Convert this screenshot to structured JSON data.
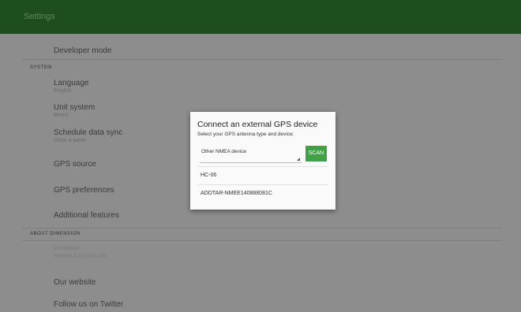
{
  "appbar": {
    "title": "Settings"
  },
  "settings": {
    "developer_mode": "Developer mode",
    "section_system": "SYSTEM",
    "language": {
      "title": "Language",
      "summary": "English"
    },
    "unit_system": {
      "title": "Unit system",
      "summary": "Metric"
    },
    "schedule_sync": {
      "title": "Schedule data sync",
      "summary": "Once a week"
    },
    "gps_source": "GPS source",
    "gps_preferences": "GPS preferences",
    "additional_features": "Additional features",
    "section_about": "ABOUT DIMENSION",
    "version": {
      "title": "Dimension",
      "summary": "Version 2.2.0 (60179)"
    },
    "our_website": "Our website",
    "follow_twitter": "Follow us on Twitter"
  },
  "dialog": {
    "title": "Connect an external GPS device",
    "subtitle": "Select your GPS antenna type and device:",
    "antenna_type": "Other NMEA device",
    "scan_label": "SCAN",
    "devices": [
      "HC-06",
      "ADDTAR-NMEE140888081C"
    ]
  },
  "colors": {
    "appbar": "#1e4d1e",
    "overlay": "#8d8d8d",
    "accent": "#43a047"
  }
}
